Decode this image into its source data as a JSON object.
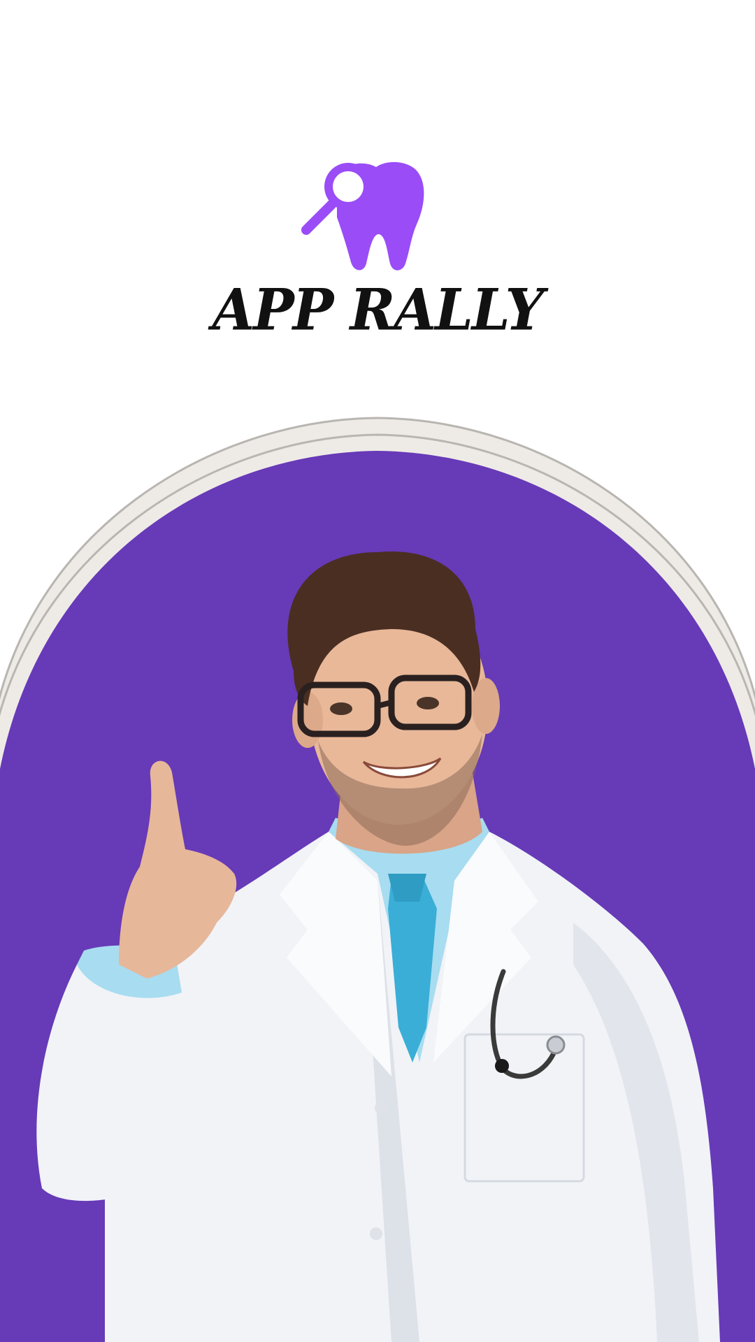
{
  "app": {
    "brand_name": "APP RALLY"
  },
  "icons": {
    "logo": "tooth-magnifier-icon"
  },
  "colors": {
    "background": "#ffffff",
    "logo_purple": "#9a4cf7",
    "hero_purple": "#673ab7",
    "arch_ring": "#eeebe7",
    "arch_ring_line": "#b9b5b1",
    "brand_text": "#111111"
  }
}
